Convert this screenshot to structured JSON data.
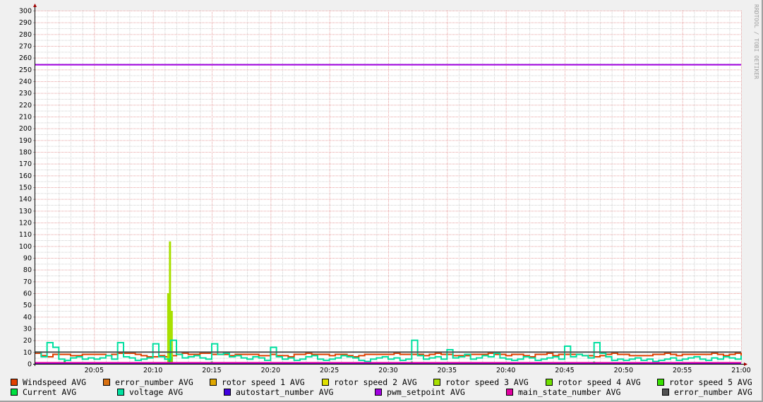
{
  "chart_data": {
    "type": "line",
    "title": "",
    "xlabel": "",
    "ylabel": "",
    "x_unit": "minutes after 20:00",
    "xlim": [
      0,
      60
    ],
    "ylim": [
      0,
      300
    ],
    "y_ticks": [
      0,
      10,
      20,
      30,
      40,
      50,
      60,
      70,
      80,
      90,
      100,
      110,
      120,
      130,
      140,
      150,
      160,
      170,
      180,
      190,
      200,
      210,
      220,
      230,
      240,
      250,
      260,
      270,
      280,
      290,
      300
    ],
    "x_ticks": [
      {
        "value": 5,
        "label": "20:05"
      },
      {
        "value": 10,
        "label": "20:10"
      },
      {
        "value": 15,
        "label": "20:15"
      },
      {
        "value": 20,
        "label": "20:20"
      },
      {
        "value": 25,
        "label": "20:25"
      },
      {
        "value": 30,
        "label": "20:30"
      },
      {
        "value": 35,
        "label": "20:35"
      },
      {
        "value": 40,
        "label": "20:40"
      },
      {
        "value": 45,
        "label": "20:45"
      },
      {
        "value": 50,
        "label": "20:50"
      },
      {
        "value": 55,
        "label": "20:55"
      },
      {
        "value": 60,
        "label": "21:00"
      }
    ],
    "grid": true,
    "legend_placement": "bottom",
    "watermark": "RRDTOOL / TOBI OETIKER",
    "series": [
      {
        "name": "Windspeed AVG",
        "color": "#e04000",
        "step": 0.5,
        "values": [
          9,
          7,
          6,
          8,
          8,
          8,
          7,
          7,
          8,
          8,
          8,
          8,
          7,
          8,
          9,
          9,
          9,
          8,
          7,
          6,
          6,
          7,
          6,
          7,
          8,
          9,
          8,
          8,
          9,
          9,
          8,
          8,
          8,
          7,
          8,
          8,
          8,
          8,
          7,
          7,
          8,
          7,
          7,
          6,
          8,
          8,
          9,
          8,
          8,
          8,
          7,
          8,
          8,
          7,
          6,
          7,
          8,
          8,
          8,
          8,
          8,
          9,
          8,
          8,
          8,
          8,
          7,
          8,
          9,
          8,
          8,
          7,
          7,
          7,
          8,
          8,
          8,
          9,
          8,
          8,
          7,
          8,
          8,
          7,
          6,
          8,
          8,
          9,
          7,
          8,
          8,
          8,
          8,
          7,
          7,
          6,
          7,
          8,
          9,
          8,
          8,
          7,
          7,
          7,
          7,
          8,
          8,
          9,
          8,
          7,
          8,
          8,
          8,
          8,
          8,
          9,
          8,
          7,
          8,
          9,
          7
        ]
      },
      {
        "name": "error_number AVG",
        "color": "#d87010",
        "constant": 0
      },
      {
        "name": "rotor speed 1 AVG",
        "color": "#e0a800",
        "constant": 0
      },
      {
        "name": "rotor speed 2 AVG",
        "color": "#e0e000",
        "constant": 0
      },
      {
        "name": "rotor speed 3 AVG",
        "color": "#a8e000",
        "points": [
          [
            11.3,
            60
          ],
          [
            11.45,
            104
          ],
          [
            11.6,
            45
          ]
        ]
      },
      {
        "name": "rotor speed 4 AVG",
        "color": "#70e000",
        "points": [
          [
            11.45,
            10
          ],
          [
            11.6,
            6
          ]
        ]
      },
      {
        "name": "rotor speed 5 AVG",
        "color": "#38e000",
        "constant": 0
      },
      {
        "name": "Current AVG",
        "color": "#00e040",
        "points": [
          [
            2.5,
            3
          ],
          [
            11.4,
            4
          ],
          [
            15,
            2
          ],
          [
            32,
            2
          ],
          [
            47.5,
            2
          ]
        ]
      },
      {
        "name": "voltage AVG",
        "color": "#00e0a0",
        "step": 0.5,
        "values": [
          10,
          6,
          18,
          14,
          4,
          3,
          5,
          6,
          4,
          5,
          4,
          5,
          7,
          4,
          18,
          6,
          5,
          3,
          4,
          5,
          17,
          6,
          4,
          20,
          8,
          5,
          6,
          7,
          5,
          4,
          17,
          8,
          9,
          6,
          7,
          5,
          4,
          6,
          5,
          3,
          14,
          6,
          4,
          5,
          3,
          4,
          6,
          7,
          4,
          3,
          4,
          5,
          7,
          6,
          5,
          3,
          2,
          4,
          5,
          6,
          4,
          5,
          3,
          4,
          20,
          7,
          4,
          5,
          6,
          4,
          12,
          5,
          6,
          8,
          4,
          5,
          7,
          6,
          9,
          5,
          4,
          3,
          4,
          6,
          5,
          3,
          4,
          5,
          6,
          4,
          15,
          6,
          8,
          7,
          5,
          18,
          9,
          6,
          3,
          4,
          3,
          4,
          5,
          3,
          4,
          2,
          3,
          4,
          5,
          3,
          4,
          5,
          6,
          4,
          3,
          5,
          4,
          6,
          5,
          4,
          7
        ]
      },
      {
        "name": "autostart_number AVG",
        "color": "#4000e0",
        "constant": 0
      },
      {
        "name": "pwm_setpoint AVG",
        "color": "#a000e0",
        "constant": 254
      },
      {
        "name": "main_state_number AVG",
        "color": "#e000a0",
        "constant": 1
      },
      {
        "name": "error_number AVG",
        "color": "#505050",
        "constant": 10
      }
    ]
  },
  "legend": {
    "row1": [
      "Windspeed AVG",
      "error_number AVG",
      "rotor speed 1 AVG",
      "rotor speed 2 AVG",
      "rotor speed 3 AVG",
      "rotor speed 4 AVG",
      "rotor speed 5 AVG"
    ],
    "row2": [
      "Current AVG",
      "voltage AVG",
      "autostart_number AVG",
      "pwm_setpoint AVG",
      "main_state_number AVG",
      "error_number AVG"
    ]
  }
}
